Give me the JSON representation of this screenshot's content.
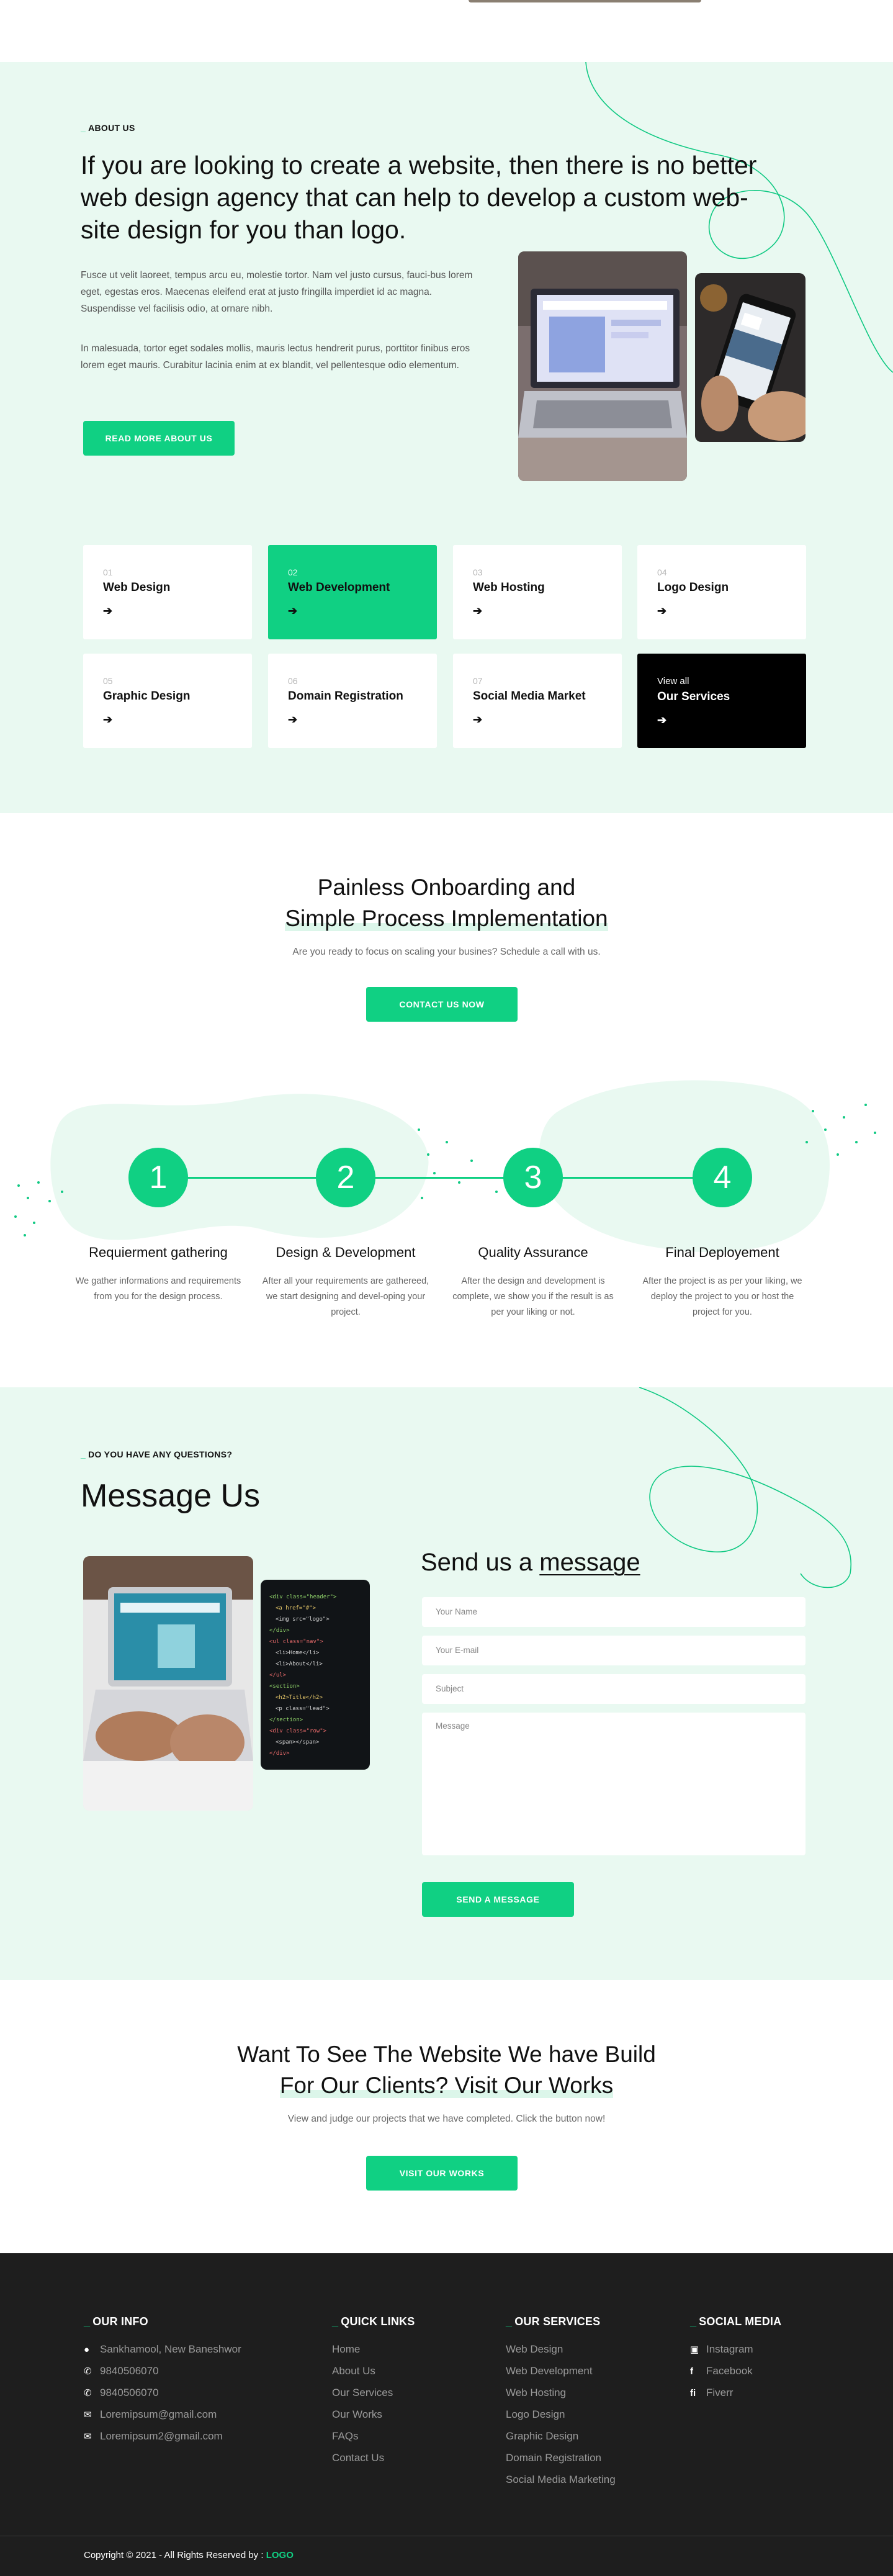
{
  "about": {
    "eyebrow": "ABOUT US",
    "title": "If you are looking to create a website, then there is no better web design agency that can help to develop a custom web-site design for you than logo.",
    "para1": "Fusce ut velit laoreet, tempus arcu eu, molestie tortor. Nam vel justo cursus, fauci-bus lorem eget, egestas eros. Maecenas eleifend erat at justo fringilla imperdiet id ac magna. Suspendisse vel facilisis odio, at ornare nibh.",
    "para2": "In malesuada, tortor eget sodales mollis, mauris lectus hendrerit purus, porttitor finibus eros lorem eget mauris. Curabitur lacinia enim at ex blandit, vel pellentesque odio elementum.",
    "button": "READ MORE ABOUT US"
  },
  "services": [
    {
      "num": "01",
      "name": "Web Design",
      "arrow": "➔"
    },
    {
      "num": "02",
      "name": "Web Development",
      "arrow": "➔"
    },
    {
      "num": "03",
      "name": "Web Hosting",
      "arrow": "➔"
    },
    {
      "num": "04",
      "name": "Logo Design",
      "arrow": "➔"
    },
    {
      "num": "05",
      "name": "Graphic Design",
      "arrow": "➔"
    },
    {
      "num": "06",
      "name": "Domain Registration",
      "arrow": "➔"
    },
    {
      "num": "07",
      "name": "Social Media Market",
      "arrow": "➔"
    },
    {
      "num": "View all",
      "name": "Our Services",
      "arrow": "➔"
    }
  ],
  "onboarding": {
    "title_line1": "Painless Onboarding and",
    "title_line2": "Simple Process Implementation",
    "subtitle": "Are you ready to focus on scaling your busines? Schedule a call with us.",
    "button": "CONTACT US NOW"
  },
  "steps": [
    {
      "num": "1",
      "title": "Requierment gathering",
      "desc": "We gather informations and requirements from you for the design process."
    },
    {
      "num": "2",
      "title": "Design & Development",
      "desc": "After all your requirements are gathereed, we start designing and devel-oping your project."
    },
    {
      "num": "3",
      "title": "Quality Assurance",
      "desc": "After the design and development is complete, we show you if the result is as per your liking or not."
    },
    {
      "num": "4",
      "title": "Final Deployement",
      "desc": "After the project is as per your liking, we deploy the project to you or host the project for you."
    }
  ],
  "message": {
    "eyebrow": "DO YOU HAVE ANY QUESTIONS?",
    "title": "Message Us",
    "send_prefix": "Send us a",
    "send_underlined": "message",
    "name_placeholder": "Your Name",
    "email_placeholder": "Your E-mail",
    "subject_placeholder": "Subject",
    "message_placeholder": "Message",
    "button": "SEND A MESSAGE"
  },
  "works": {
    "title_line1": "Want To See The Website We have Build",
    "title_line2": "For Our Clients? Visit Our Works",
    "subtitle": "View and judge our projects that we have completed. Click the button now!",
    "button": "VISIT OUR WORKS"
  },
  "footer": {
    "info_head": "OUR INFO",
    "info": [
      {
        "icon": "location-pin-icon",
        "text": "Sankhamool, New Baneshwor"
      },
      {
        "icon": "phone-icon",
        "text": "9840506070"
      },
      {
        "icon": "phone-icon",
        "text": "9840506070"
      },
      {
        "icon": "envelope-icon",
        "text": "Loremipsum@gmail.com"
      },
      {
        "icon": "envelope-icon",
        "text": "Loremipsum2@gmail.com"
      }
    ],
    "links_head": "QUICK LINKS",
    "links": [
      "Home",
      "About Us",
      "Our Services",
      "Our Works",
      "FAQs",
      "Contact Us"
    ],
    "services_head": "OUR SERVICES",
    "services": [
      "Web Design",
      "Web Development",
      "Web Hosting",
      "Logo Design",
      "Graphic Design",
      "Domain Registration",
      "Social Media Marketing"
    ],
    "social_head": "SOCIAL MEDIA",
    "social": [
      {
        "icon": "instagram-icon",
        "text": "Instagram"
      },
      {
        "icon": "facebook-icon",
        "text": "Facebook"
      },
      {
        "icon": "fiverr-icon",
        "text": "Fiverr"
      }
    ],
    "copyright": "Copyright © 2021 - All Rights Reserved by :",
    "copyright_logo": "LOGO"
  },
  "colors": {
    "accent": "#10d083",
    "mint_bg": "#e9f9f1",
    "footer_bg": "#1e1e1e"
  }
}
